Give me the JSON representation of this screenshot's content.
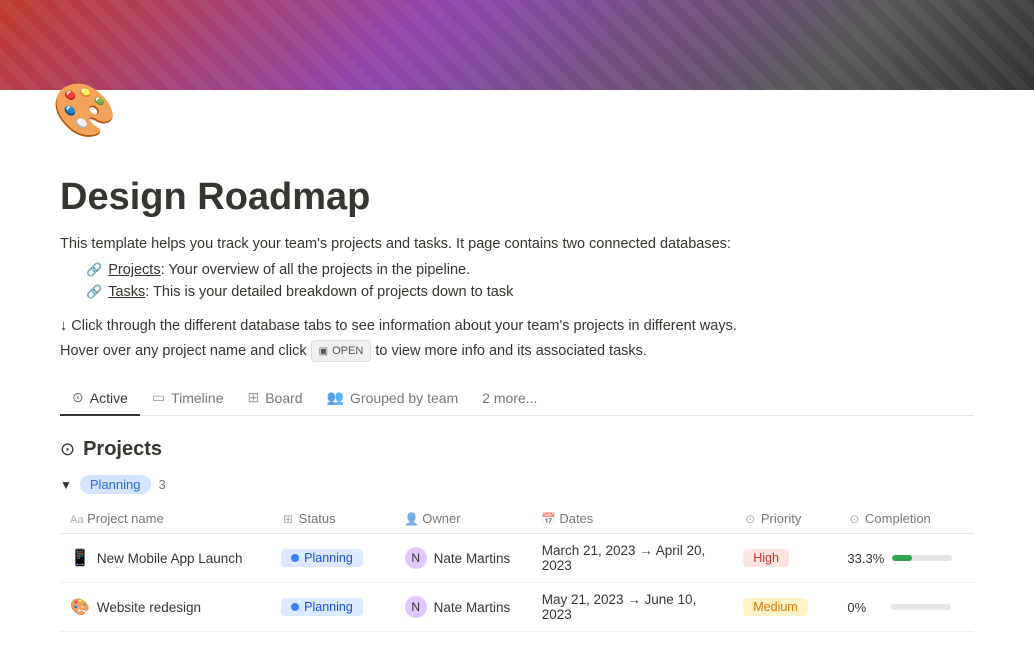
{
  "banner": {
    "alt": "Design Roadmap banner"
  },
  "page": {
    "icon": "🎨",
    "title": "Design Roadmap",
    "description": "This template helps you track your team's projects and tasks. It page contains two connected databases:",
    "bullets": [
      {
        "icon": "🔗",
        "link_text": "Projects",
        "rest": ": Your overview of all the projects in the pipeline."
      },
      {
        "icon": "🔗",
        "link_text": "Tasks",
        "rest": ": This is your detailed breakdown of projects down to task"
      }
    ],
    "hint_line1": "↓ Click through the different database tabs to see information about your team's projects in different ways.",
    "hint_line2": "Hover over any project name and click",
    "open_badge": "OPEN",
    "hint_line3": "to view more info and its associated tasks."
  },
  "tabs": [
    {
      "id": "active",
      "label": "Active",
      "icon": "⊙",
      "active": true
    },
    {
      "id": "timeline",
      "label": "Timeline",
      "icon": "▭",
      "active": false
    },
    {
      "id": "board",
      "label": "Board",
      "icon": "⊞",
      "active": false
    },
    {
      "id": "grouped",
      "label": "Grouped by team",
      "icon": "👥",
      "active": false
    },
    {
      "id": "more",
      "label": "2 more...",
      "icon": "",
      "active": false
    }
  ],
  "projects_section": {
    "icon": "⊙",
    "title": "Projects",
    "group": {
      "name": "Planning",
      "count": "3",
      "color": "#2f6fce",
      "bg": "#d3e4ff"
    },
    "table": {
      "columns": [
        {
          "id": "name",
          "label": "Project name",
          "prefix": "Aa"
        },
        {
          "id": "status",
          "label": "Status",
          "icon": "⊞"
        },
        {
          "id": "owner",
          "label": "Owner",
          "icon": "👤"
        },
        {
          "id": "dates",
          "label": "Dates",
          "icon": "📅"
        },
        {
          "id": "priority",
          "label": "Priority",
          "icon": "⊙"
        },
        {
          "id": "completion",
          "label": "Completion",
          "icon": "⊙"
        }
      ],
      "rows": [
        {
          "id": "row1",
          "name": "New Mobile App Launch",
          "emoji": "📱",
          "status": "Planning",
          "owner_name": "Nate Martins",
          "owner_avatar": "N",
          "dates": "March 21, 2023 → April 20, 2023",
          "priority": "High",
          "priority_type": "high",
          "completion_pct": "33.3%",
          "completion_val": 33
        },
        {
          "id": "row2",
          "name": "Website redesign",
          "emoji": "🎨",
          "status": "Planning",
          "owner_name": "Nate Martins",
          "owner_avatar": "N",
          "dates": "May 21, 2023 → June 10, 2023",
          "priority": "Medium",
          "priority_type": "medium",
          "completion_pct": "0%",
          "completion_val": 0
        }
      ]
    }
  }
}
